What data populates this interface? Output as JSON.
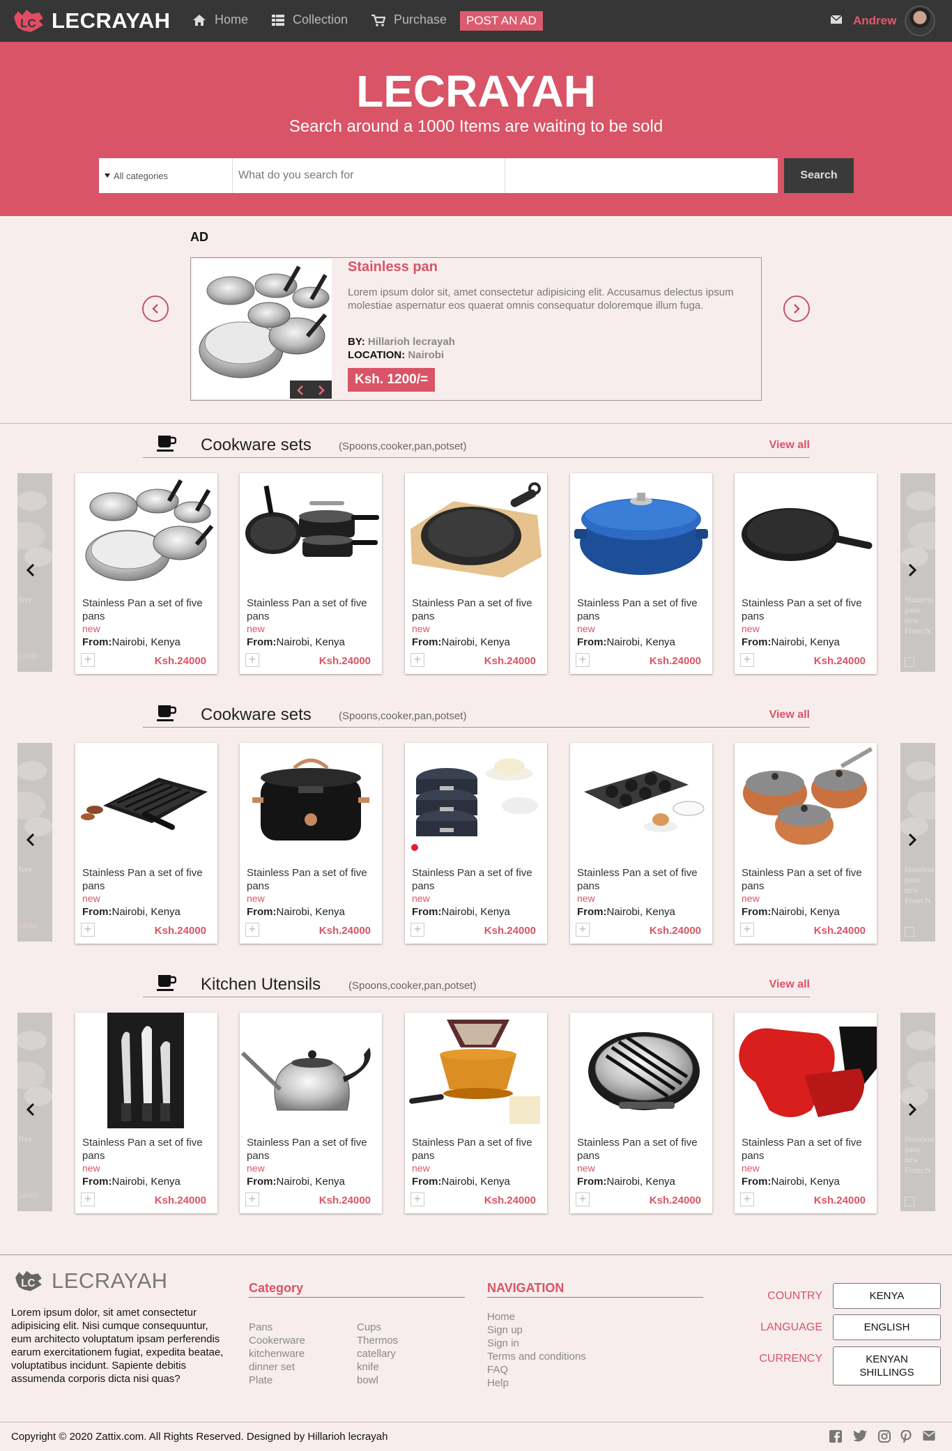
{
  "brand": {
    "name": "LECRAYAH"
  },
  "nav": {
    "items": [
      {
        "label": "Home",
        "icon": "home-icon"
      },
      {
        "label": "Collection",
        "icon": "grid-icon"
      },
      {
        "label": "Purchase",
        "icon": "cart-icon"
      }
    ],
    "post_ad": "POST AN AD",
    "user": {
      "name": "Andrew",
      "mail_icon": "envelope-icon"
    }
  },
  "hero": {
    "title": "LECRAYAH",
    "subtitle": "Search around a 1000 Items are waiting to be sold",
    "search": {
      "category": "All categories",
      "placeholder": "What do you search for",
      "button": "Search"
    }
  },
  "ad": {
    "label": "AD",
    "title": "Stainless pan",
    "description": "Lorem ipsum dolor sit, amet consectetur adipisicing elit. Accusamus delectus ipsum molestiae aspernatur eos quaerat omnis consequatur doloremque illum fuga.",
    "by_label": "BY:",
    "by": "Hillarioh lecrayah",
    "location_label": "LOCATION:",
    "location": "Nairobi",
    "price": "Ksh. 1200/="
  },
  "sections": [
    {
      "title": "Cookware sets",
      "subtitle": "(Spoons,cooker,pan,potset)",
      "view_all": "View all",
      "products": [
        {
          "name": "Stainless Pan a set of five pans",
          "condition": "new",
          "from_label": "From:",
          "location": "Nairobi, Kenya",
          "price": "Ksh.24000",
          "image": "pot-set"
        },
        {
          "name": "Stainless Pan a set of five pans",
          "condition": "new",
          "from_label": "From:",
          "location": "Nairobi, Kenya",
          "price": "Ksh.24000",
          "image": "nonstick-set"
        },
        {
          "name": "Stainless Pan a set of five pans",
          "condition": "new",
          "from_label": "From:",
          "location": "Nairobi, Kenya",
          "price": "Ksh.24000",
          "image": "cast-iron-skillet-board"
        },
        {
          "name": "Stainless Pan a set of five pans",
          "condition": "new",
          "from_label": "From:",
          "location": "Nairobi, Kenya",
          "price": "Ksh.24000",
          "image": "blue-dutch-oven"
        },
        {
          "name": "Stainless Pan a set of five pans",
          "condition": "new",
          "from_label": "From:",
          "location": "Nairobi, Kenya",
          "price": "Ksh.24000",
          "image": "cast-iron-skillet"
        }
      ]
    },
    {
      "title": "Cookware sets",
      "subtitle": "(Spoons,cooker,pan,potset)",
      "view_all": "View all",
      "products": [
        {
          "name": "Stainless Pan a set of five pans",
          "condition": "new",
          "from_label": "From:",
          "location": "Nairobi, Kenya",
          "price": "Ksh.24000",
          "image": "grill-tray"
        },
        {
          "name": "Stainless Pan a set of five pans",
          "condition": "new",
          "from_label": "From:",
          "location": "Nairobi, Kenya",
          "price": "Ksh.24000",
          "image": "slow-cooker"
        },
        {
          "name": "Stainless Pan a set of five pans",
          "condition": "new",
          "from_label": "From:",
          "location": "Nairobi, Kenya",
          "price": "Ksh.24000",
          "image": "springform-tins"
        },
        {
          "name": "Stainless Pan a set of five pans",
          "condition": "new",
          "from_label": "From:",
          "location": "Nairobi, Kenya",
          "price": "Ksh.24000",
          "image": "muffin-trays"
        },
        {
          "name": "Stainless Pan a set of five pans",
          "condition": "new",
          "from_label": "From:",
          "location": "Nairobi, Kenya",
          "price": "Ksh.24000",
          "image": "copper-pans"
        }
      ]
    },
    {
      "title": "Kitchen Utensils",
      "subtitle": "(Spoons,cooker,pan,potset)",
      "view_all": "View all",
      "products": [
        {
          "name": "Stainless Pan a set of five pans",
          "condition": "new",
          "from_label": "From:",
          "location": "Nairobi, Kenya",
          "price": "Ksh.24000",
          "image": "knife-set"
        },
        {
          "name": "Stainless Pan a set of five pans",
          "condition": "new",
          "from_label": "From:",
          "location": "Nairobi, Kenya",
          "price": "Ksh.24000",
          "image": "kettle"
        },
        {
          "name": "Stainless Pan a set of five pans",
          "condition": "new",
          "from_label": "From:",
          "location": "Nairobi, Kenya",
          "price": "Ksh.24000",
          "image": "coffee-filter"
        },
        {
          "name": "Stainless Pan a set of five pans",
          "condition": "new",
          "from_label": "From:",
          "location": "Nairobi, Kenya",
          "price": "Ksh.24000",
          "image": "egg-slicer"
        },
        {
          "name": "Stainless Pan a set of five pans",
          "condition": "new",
          "from_label": "From:",
          "location": "Nairobi, Kenya",
          "price": "Ksh.24000",
          "image": "oven-gloves"
        }
      ]
    }
  ],
  "ghost": {
    "left_text": "five",
    "left_price": "24000",
    "right_text": "Stainless pans new From:N"
  },
  "footer": {
    "brand": "LECRAYAH",
    "about": "Lorem ipsum dolor, sit amet consectetur adipisicing elit. Nisi cumque consequuntur, eum architecto voluptatum ipsam perferendis earum exercitationem fugiat, expedita beatae, voluptatibus incidunt. Sapiente debitis assumenda corporis dicta nisi quas?",
    "category_title": "Category",
    "category_col1": [
      "Pans",
      "Cookerware",
      "kitchenware",
      "dinner set",
      "Plate"
    ],
    "category_col2": [
      "Cups",
      "Thermos",
      "catellary",
      "knife",
      "bowl"
    ],
    "navigation_title": "NAVIGATION",
    "navigation": [
      "Home",
      "Sign up",
      "Sign in",
      "Terms and conditions",
      "FAQ",
      "Help"
    ],
    "settings": [
      {
        "label": "COUNTRY",
        "value": "KENYA"
      },
      {
        "label": "LANGUAGE",
        "value": "ENGLISH"
      },
      {
        "label": "CURRENCY",
        "value": "KENYAN SHILLINGS"
      }
    ],
    "copyright": "Copyright © 2020 Zattix.com. All Rights Reserved. Designed by Hillarioh lecrayah",
    "social": [
      "facebook-icon",
      "twitter-icon",
      "instagram-icon",
      "pinterest-icon",
      "email-icon"
    ]
  },
  "colors": {
    "accent": "#d95466",
    "nav_bg": "#363636",
    "page_bg": "#f8eded"
  }
}
